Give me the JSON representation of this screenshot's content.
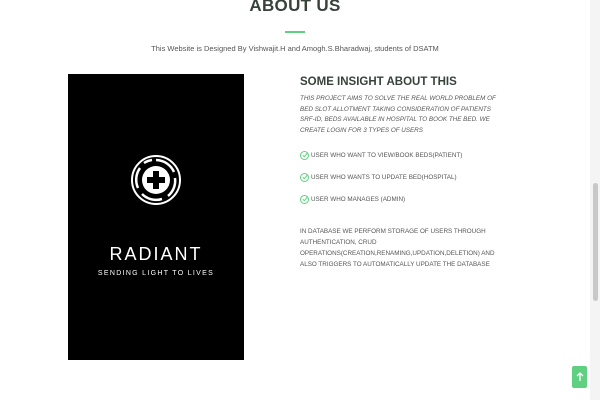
{
  "section": {
    "title": "ABOUT US",
    "credit": "This Website is Designed By Vishwajit.H and Amogh.S.Bharadwaj, students of DSATM"
  },
  "logo": {
    "name": "RADIANT",
    "tagline": "SENDING LIGHT TO LIVES",
    "icon": "shutter-cross-icon"
  },
  "content": {
    "heading": "SOME INSIGHT ABOUT THIS",
    "intro": "THIS PROJECT AIMS TO SOLVE THE REAL WORLD PROBLEM OF BED SLOT ALLOTMENT TAKING CONSIDERATION OF PATIENTS SRF-ID, BEDS AVAILABLE IN HOSPITAL TO BOOK THE BED. WE CREATE LOGIN FOR 3 TYPES OF USERS",
    "users": [
      "USER WHO WANT TO VIEW/BOOK BEDS(PATIENT)",
      "USER WHO WANTS TO UPDATE BED(HOSPITAL)",
      "USER WHO MANAGES (ADMIN)"
    ],
    "note": "IN DATABASE WE PERFORM STORAGE OF USERS THROUGH AUTHENTICATION, CRUD OPERATIONS(CREATION,RENAMING,UPDATION,DELETION) AND ALSO TRIGGERS TO AUTOMATICALLY UPDATE THE DATABASE"
  },
  "colors": {
    "accent": "#5fcf80",
    "logo_background": "#000000",
    "heading": "#37423b"
  },
  "back_to_top_icon": "arrow-up-icon"
}
